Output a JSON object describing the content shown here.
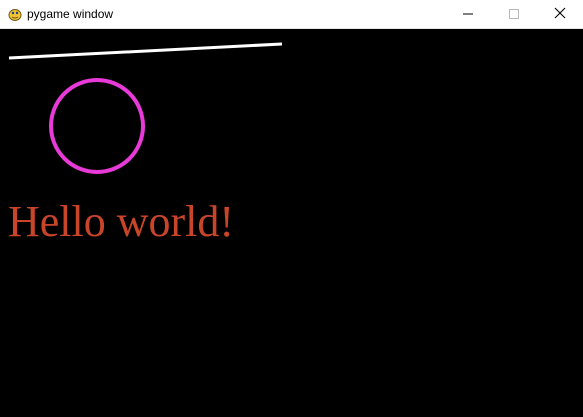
{
  "window": {
    "title": "pygame window",
    "app_icon": "pygame-snake-icon",
    "controls": {
      "minimize_icon": "minimize-icon",
      "maximize_icon": "maximize-icon",
      "close_icon": "close-icon"
    }
  },
  "canvas": {
    "background_color": "#000000",
    "line": {
      "color": "#ffffff"
    },
    "circle": {
      "color": "#e83ad9"
    },
    "text": {
      "content": "Hello world!",
      "color": "#c8452a"
    }
  }
}
